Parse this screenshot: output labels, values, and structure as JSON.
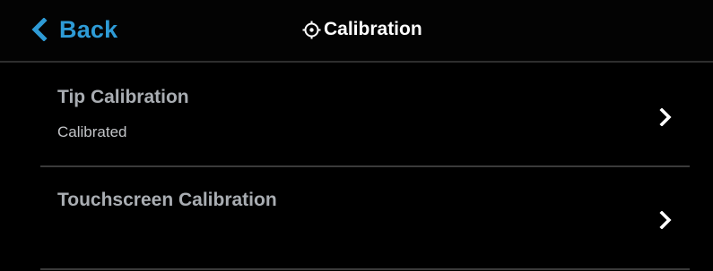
{
  "header": {
    "back_label": "Back",
    "title": "Calibration",
    "title_icon": "target-icon",
    "back_icon": "chevron-left-icon",
    "accent_color": "#2e9bd6"
  },
  "menu": {
    "items": [
      {
        "title": "Tip Calibration",
        "subtitle": "Calibrated",
        "icon": "chevron-right-icon"
      },
      {
        "title": "Touchscreen Calibration",
        "subtitle": "",
        "icon": "chevron-right-icon"
      }
    ]
  }
}
